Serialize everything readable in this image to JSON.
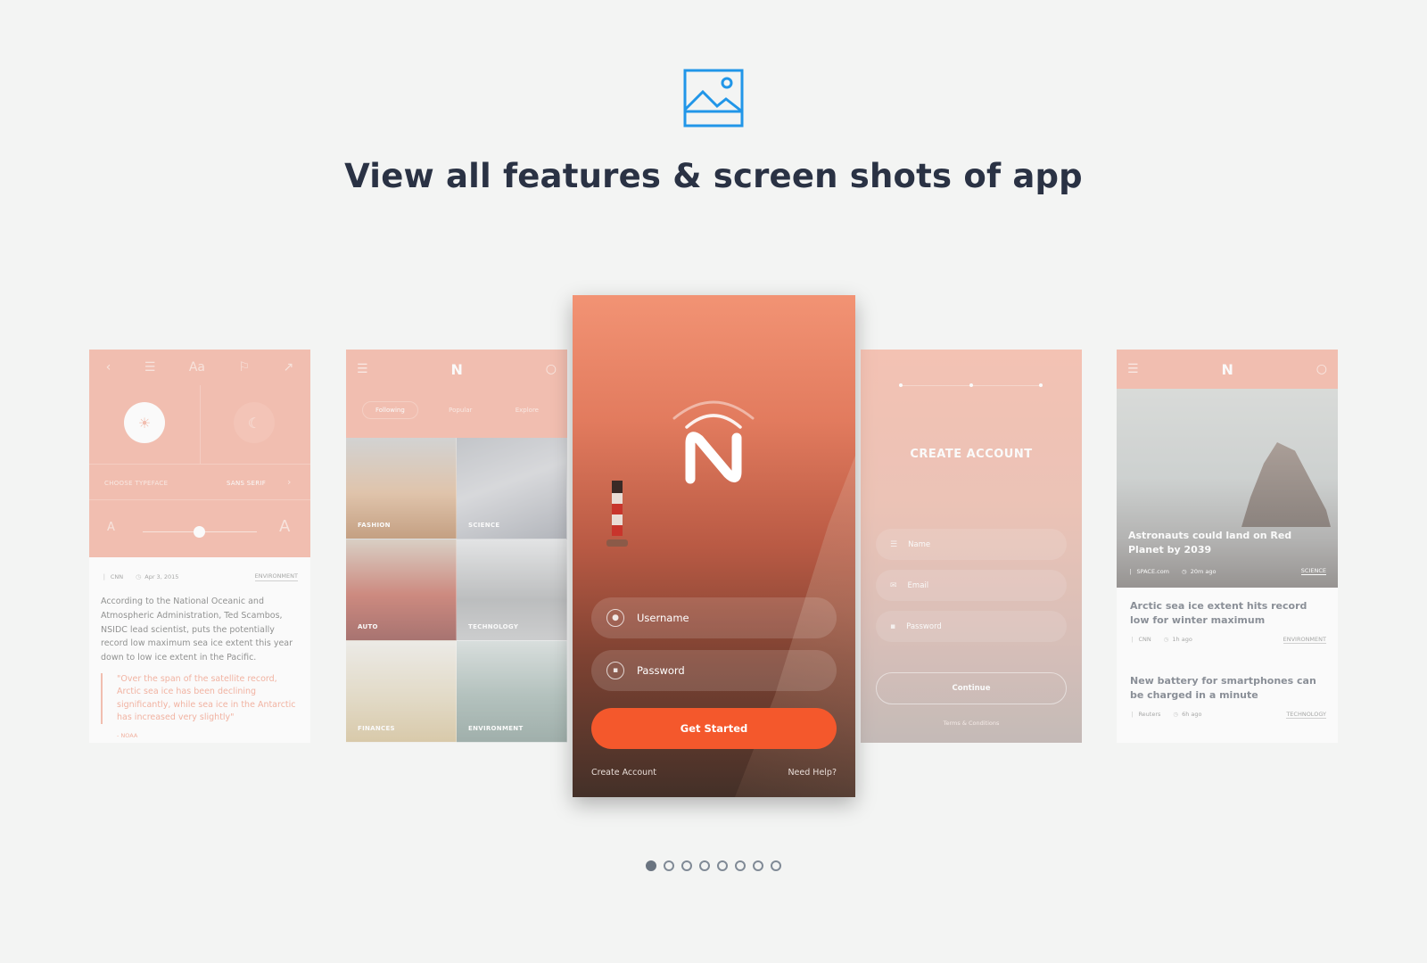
{
  "header": {
    "icon": "image-icon",
    "accent_color": "#2196e8",
    "title": "View all features & screen shots of app"
  },
  "reading_settings": {
    "typeface_label": "CHOOSE TYPEFACE",
    "typeface_value": "SANS SERIF",
    "font_size_small": "A",
    "font_size_large": "A",
    "toolbar_font_label": "Aa",
    "font_size_level": 0.5,
    "article": {
      "source": "CNN",
      "date": "Apr 3, 2015",
      "category": "ENVIRONMENT",
      "body": "According to the National Oceanic and Atmospheric Administration, Ted Scambos, NSIDC lead scientist, puts the potentially record low maximum sea ice extent this year down to low ice extent in the Pacific.",
      "quote": "\"Over the span of the satellite record, Arctic sea ice has been declining significantly, while sea ice in the Antarctic has increased very slightly\"",
      "quote_source": "- NOAA"
    }
  },
  "categories_screen": {
    "logo": "N",
    "tabs": [
      "Following",
      "Popular",
      "Explore"
    ],
    "categories": [
      "FASHION",
      "SCIENCE",
      "AUTO",
      "TECHNOLOGY",
      "FINANCES",
      "ENVIRONMENT"
    ]
  },
  "login_screen": {
    "username_placeholder": "Username",
    "password_placeholder": "Password",
    "button": "Get Started",
    "create_account": "Create Account",
    "need_help": "Need Help?",
    "button_color": "#f4582c"
  },
  "create_account_screen": {
    "title": "CREATE ACCOUNT",
    "name_placeholder": "Name",
    "email_placeholder": "Email",
    "password_placeholder": "Password",
    "continue": "Continue",
    "terms": "Terms & Conditions"
  },
  "news_screen": {
    "logo": "N",
    "hero": {
      "title": "Astronauts could land on Red Planet by 2039",
      "source": "SPACE.com",
      "time": "20m ago",
      "category": "SCIENCE"
    },
    "articles": [
      {
        "title": "Arctic sea ice extent hits record low for winter maximum",
        "source": "CNN",
        "time": "1h ago",
        "category": "ENVIRONMENT"
      },
      {
        "title": "New battery for smartphones can be charged in a minute",
        "source": "Reuters",
        "time": "6h ago",
        "category": "TECHNOLOGY"
      }
    ]
  },
  "pagination": {
    "pages": 8,
    "current": 1
  }
}
